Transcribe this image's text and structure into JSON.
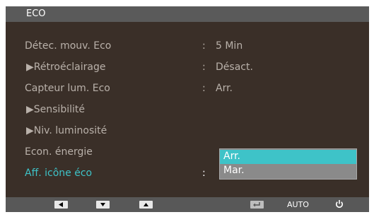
{
  "title": "ECO",
  "menu": [
    {
      "label": "Détec. mouv. Eco",
      "value": "5 Min",
      "colon": ":"
    },
    {
      "label": "▶Rétroéclairage",
      "value": "Désact.",
      "colon": ":"
    },
    {
      "label": "Capteur lum. Eco",
      "value": "Arr.",
      "colon": ":"
    },
    {
      "label": "▶Sensibilité"
    },
    {
      "label": "▶Niv. luminosité"
    },
    {
      "label": "Econ. énergie"
    },
    {
      "label": "Aff. icône éco",
      "colon": ":"
    }
  ],
  "dropdown": {
    "options": [
      "Arr.",
      "Mar."
    ],
    "selected": "Arr."
  },
  "footer": {
    "auto_label": "AUTO"
  },
  "colors": {
    "accent": "#3ec3c8",
    "background": "#3a2f28"
  }
}
